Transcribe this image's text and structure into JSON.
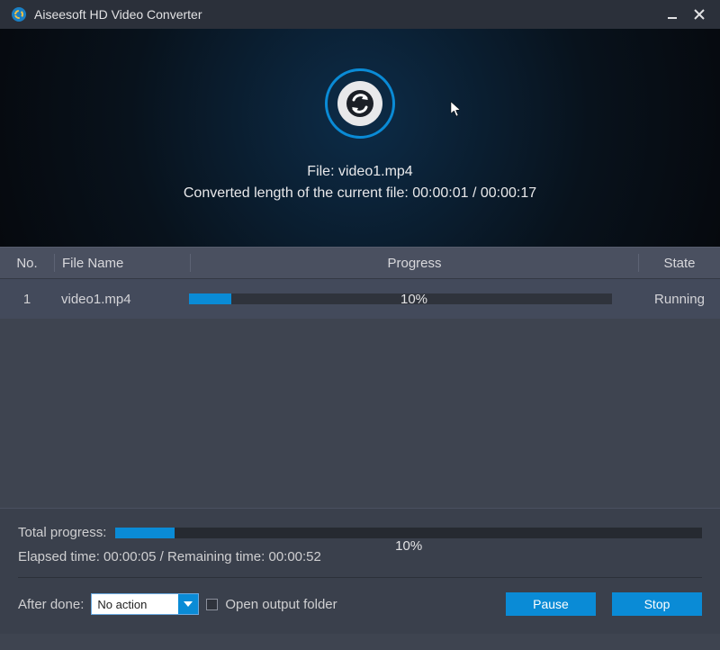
{
  "titlebar": {
    "app_title": "Aiseesoft HD Video Converter"
  },
  "hero": {
    "file_line": "File: video1.mp4",
    "length_line": "Converted length of the current file: 00:00:01 / 00:00:17"
  },
  "table": {
    "headers": {
      "no": "No.",
      "name": "File Name",
      "progress": "Progress",
      "state": "State"
    },
    "rows": [
      {
        "no": "1",
        "name": "video1.mp4",
        "progress_pct": 10,
        "progress_label": "10%",
        "state": "Running"
      }
    ]
  },
  "footer": {
    "total_label": "Total progress:",
    "total_pct": 10,
    "total_pct_label": "10%",
    "timing": "Elapsed time: 00:00:05 / Remaining time: 00:00:52",
    "after_done_label": "After done:",
    "after_done_value": "No action",
    "open_output_label": "Open output folder",
    "open_output_checked": false,
    "buttons": {
      "pause": "Pause",
      "stop": "Stop"
    }
  }
}
